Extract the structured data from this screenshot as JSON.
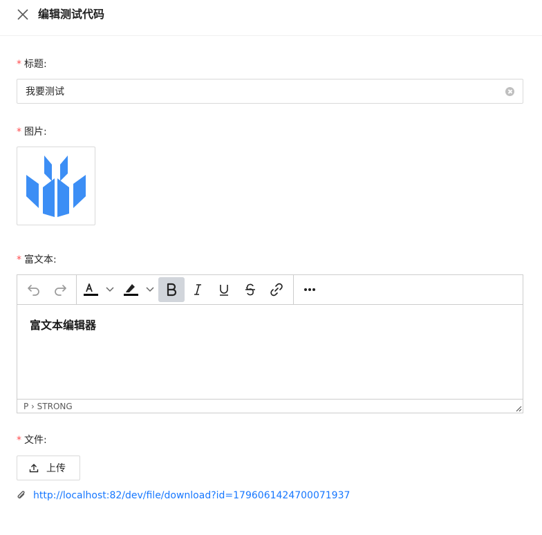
{
  "header": {
    "title": "编辑测试代码",
    "close_icon": "close-icon"
  },
  "form": {
    "title_field": {
      "required_mark": "*",
      "label": "标题:",
      "value": "我要测试"
    },
    "image_field": {
      "required_mark": "*",
      "label": "图片:"
    },
    "richtext_field": {
      "required_mark": "*",
      "label": "富文本:",
      "toolbar": [
        "undo-icon",
        "redo-icon",
        "text-color-icon",
        "highlight-icon",
        "bold-icon",
        "italic-icon",
        "underline-icon",
        "strikethrough-icon",
        "link-icon",
        "more-icon"
      ],
      "content": "富文本编辑器",
      "path": "P › STRONG",
      "text_color": "#1a1a1a"
    },
    "file_field": {
      "required_mark": "*",
      "label": "文件:",
      "upload_label": "上传",
      "file_url": "http://localhost:82/dev/file/download?id=1796061424700071937"
    }
  },
  "colors": {
    "required": "#ff4d4f",
    "link": "#1677ff",
    "logo": "#3c8ef5"
  }
}
